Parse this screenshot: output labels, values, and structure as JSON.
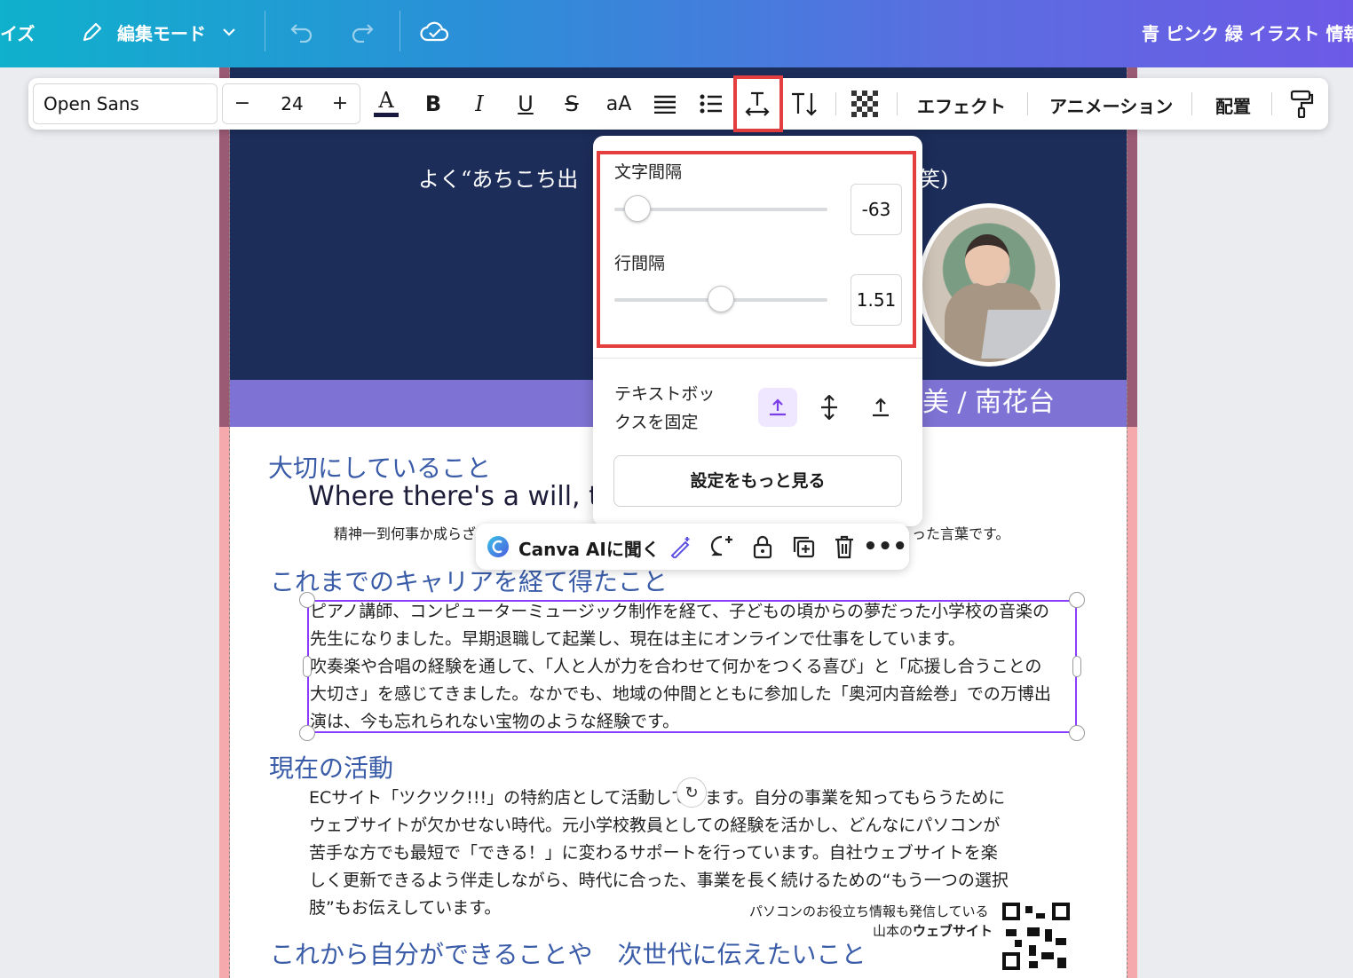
{
  "topbar": {
    "left_fragment": "イズ",
    "edit_mode": "編集モード",
    "doc_title": "青 ピンク 緑 イラスト 情報"
  },
  "toolbar": {
    "font": "Open Sans",
    "font_size": "24",
    "minus": "−",
    "plus": "+",
    "bold": "B",
    "italic": "I",
    "underline": "U",
    "strike": "S",
    "case": "aA",
    "effects": "エフェクト",
    "animation": "アニメーション",
    "position": "配置"
  },
  "spacing_popup": {
    "letter_spacing_label": "文字間隔",
    "letter_spacing_value": "-63",
    "letter_spacing_fraction": 0.11,
    "line_spacing_label": "行間隔",
    "line_spacing_value": "1.51",
    "line_spacing_fraction": 0.5,
    "anchor_label_line1": "テキストボッ",
    "anchor_label_line2": "クスを固定",
    "more_settings": "設定をもっと見る"
  },
  "ai_bar": {
    "label": "Canva AIに聞く"
  },
  "document": {
    "subtitle_left": "よく“あちこち出",
    "subtitle_right": "笑)",
    "name_fragment": "美 / 南花台",
    "section1_heading": "大切にしていること",
    "quote": "Where there's a will, the",
    "quote_note_left": "精神一到何事か成らざ",
    "quote_note_right": "った言葉です。",
    "section2_heading": "これまでのキャリアを経て得たこと",
    "career_lines": [
      "ピアノ講師、コンピューターミュージック制作を経て、子どもの頃からの夢だった小学校の音楽の",
      "先生になりました。早期退職して起業し、現在は主にオンラインで仕事をしています。",
      "吹奏楽や合唱の経験を通して、「人と人が力を合わせて何かをつくる喜び」と「応援し合うことの",
      "大切さ」を感じてきました。なかでも、地域の仲間とともに参加した「奥河内音絵巻」での万博出",
      "演は、今も忘れられない宝物のような経験です。"
    ],
    "section3_heading": "現在の活動",
    "activity_lines": [
      "ECサイト「ツクツク!!!」の特約店として活動しています。自分の事業を知ってもらうために",
      "ウェブサイトが欠かせない時代。元小学校教員としての経験を活かし、どんなにパソコンが",
      "苦手な方でも最短で「できる！」に変わるサポートを行っています。自社ウェブサイトを楽",
      "しく更新できるよう伴走しながら、時代に合った、事業を長く続けるための“もう一つの選択",
      "肢”もお伝えしています。"
    ],
    "qr_caption_line1": "パソコンのお役立ち情報も発信している",
    "qr_caption_line2_prefix": "山本の",
    "qr_caption_line2_bold": "ウェブサイト",
    "section4_heading": "これから自分ができることや　次世代に伝えたいこと"
  },
  "colors": {
    "topbar_gradient": [
      "#0fb1cc",
      "#6d5ae6"
    ],
    "header_bg": "#1c2d5a",
    "heading_blue": "#3a5ca8",
    "highlight_red": "#e53e3e",
    "selection_purple": "#8b3dff"
  }
}
